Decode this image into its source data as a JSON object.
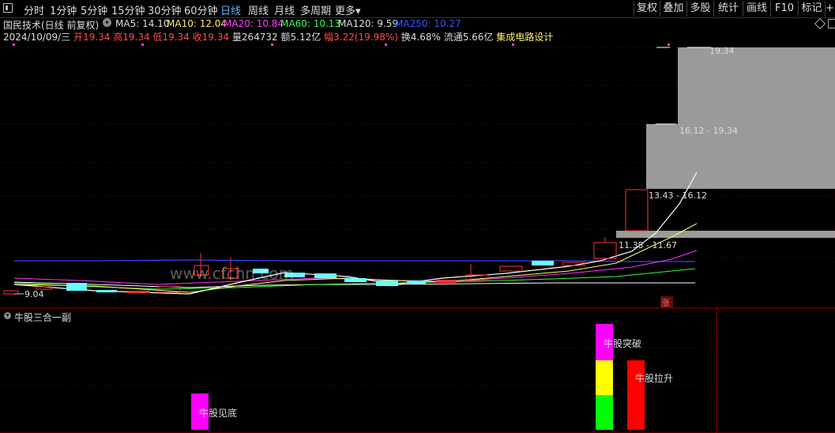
{
  "toolbar": {
    "periods": [
      "分时",
      "1分钟",
      "5分钟",
      "15分钟",
      "30分钟",
      "60分钟",
      "日线",
      "周线",
      "月线",
      "多周期",
      "更多"
    ],
    "active_period": "日线",
    "more_arrow": "▾",
    "right_buttons": [
      "复权",
      "叠加",
      "多股",
      "统计",
      "画线",
      "F10",
      "标记",
      "+自"
    ]
  },
  "header": {
    "stock_title": "国民技术(日线 前复权)",
    "ma5": "MA5: 14.10",
    "ma10": "MA10: 12.04",
    "ma20": "MA20: 10.84",
    "ma60": "MA60: 10.13",
    "ma120": "MA120: 9.59",
    "ma250": "MA250: 10.27",
    "date": "2024/10/09/三",
    "open_label": "开",
    "open": "19.34",
    "high_label": "高",
    "high": "19.34",
    "low_label": "低",
    "low": "19.34",
    "close_label": "收",
    "close": "19.34",
    "volume": "量264732",
    "amount": "额5.12亿",
    "change_label": "幅",
    "change": "3.22(19.98%)",
    "turnover": "换4.68%",
    "float_cap": "流通5.66亿",
    "sector": "集成电路设计"
  },
  "chart": {
    "price_low_label": "9.04",
    "zones": [
      "19.34",
      "16.12 - 19.34",
      "13.43 - 16.12",
      "11.38 - 11.67"
    ],
    "watermark": "www.cfchn.com",
    "zhang_tag": "涨",
    "colors": {
      "ma5": "#ffffff",
      "ma10": "#ffff00",
      "ma20": "#ff33ff",
      "ma60": "#33ff33",
      "ma120": "#3344ff",
      "zone": "#9a9a9a",
      "up": "#ff3333",
      "down": "#66ffff"
    }
  },
  "indicator": {
    "title": "牛股三合一副",
    "signals": [
      "牛股见底",
      "牛股突破",
      "牛股拉升"
    ],
    "colors": {
      "bottom": "#ff00ff",
      "breakout_top": "#ff00ff",
      "breakout_mid": "#ffff00",
      "breakout_low": "#00ff00",
      "rise": "#ff0000"
    }
  }
}
